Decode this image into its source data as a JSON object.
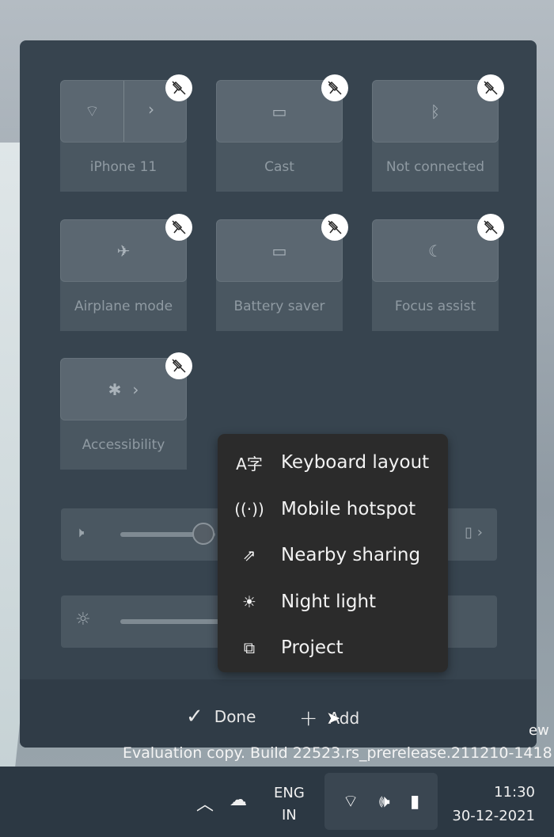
{
  "tiles": [
    {
      "label": "iPhone 11",
      "icon": "wifi-icon",
      "has_chevron": true
    },
    {
      "label": "Cast",
      "icon": "cast-icon"
    },
    {
      "label": "Not connected",
      "icon": "bluetooth-icon"
    },
    {
      "label": "Airplane mode",
      "icon": "airplane-icon"
    },
    {
      "label": "Battery saver",
      "icon": "battery-saver-icon"
    },
    {
      "label": "Focus assist",
      "icon": "moon-icon"
    },
    {
      "label": "Accessibility",
      "icon": "accessibility-icon",
      "has_chevron": true
    }
  ],
  "menu": {
    "items": [
      {
        "label": "Keyboard layout",
        "icon": "keyboard-layout-icon"
      },
      {
        "label": "Mobile hotspot",
        "icon": "hotspot-icon"
      },
      {
        "label": "Nearby sharing",
        "icon": "nearby-sharing-icon"
      },
      {
        "label": "Night light",
        "icon": "night-light-icon"
      },
      {
        "label": "Project",
        "icon": "project-icon"
      }
    ]
  },
  "footer": {
    "done": "Done",
    "add": "Add"
  },
  "watermark": {
    "line1": "ew",
    "line2": "Evaluation copy. Build 22523.rs_prerelease.211210-1418"
  },
  "taskbar": {
    "lang1": "ENG",
    "lang2": "IN",
    "time": "11:30",
    "date": "30-12-2021"
  }
}
